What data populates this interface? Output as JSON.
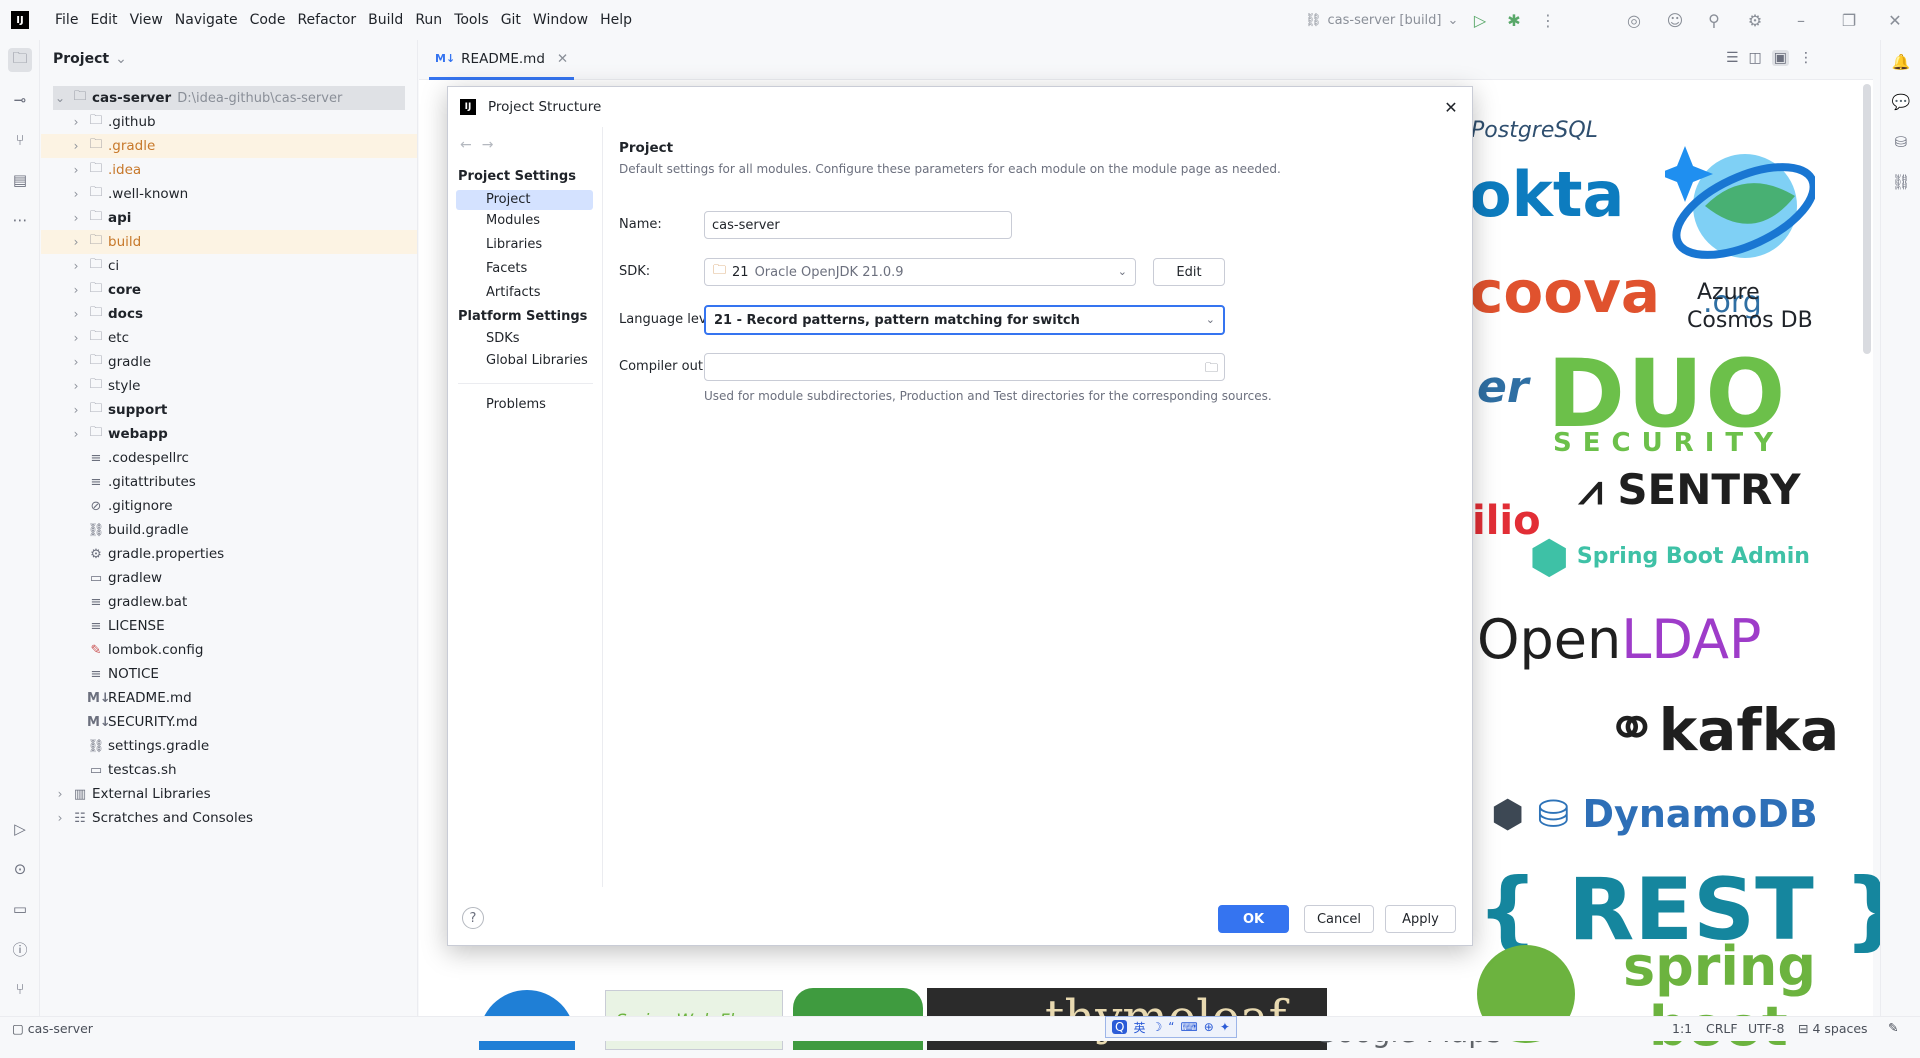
{
  "menu": [
    "File",
    "Edit",
    "View",
    "Navigate",
    "Code",
    "Refactor",
    "Build",
    "Run",
    "Tools",
    "Git",
    "Window",
    "Help"
  ],
  "run_config": "cas-server [build]",
  "project_panel": {
    "title": "Project",
    "root_name": "cas-server",
    "root_path": "D:\\idea-github\\cas-server",
    "items": [
      {
        "label": ".github"
      },
      {
        "label": ".gradle"
      },
      {
        "label": ".idea"
      },
      {
        "label": ".well-known"
      },
      {
        "label": "api"
      },
      {
        "label": "build"
      },
      {
        "label": "ci"
      },
      {
        "label": "core"
      },
      {
        "label": "docs"
      },
      {
        "label": "etc"
      },
      {
        "label": "gradle"
      },
      {
        "label": "style"
      },
      {
        "label": "support"
      },
      {
        "label": "webapp"
      },
      {
        "label": ".codespellrc"
      },
      {
        "label": ".gitattributes"
      },
      {
        "label": ".gitignore"
      },
      {
        "label": "build.gradle"
      },
      {
        "label": "gradle.properties"
      },
      {
        "label": "gradlew"
      },
      {
        "label": "gradlew.bat"
      },
      {
        "label": "LICENSE"
      },
      {
        "label": "lombok.config"
      },
      {
        "label": "NOTICE"
      },
      {
        "label": "README.md"
      },
      {
        "label": "SECURITY.md"
      },
      {
        "label": "settings.gradle"
      },
      {
        "label": "testcas.sh"
      }
    ],
    "external_libraries": "External Libraries",
    "scratches": "Scratches and Consoles"
  },
  "editor": {
    "tab_label": "README.md",
    "md_badge": "M↓"
  },
  "preview_logos": {
    "postgresql": "PostgreSQL",
    "okta": "okta",
    "coova": "coova",
    "coova_org": ".org",
    "azure": "Azure",
    "cosmos": "Cosmos DB",
    "duo": "DUO",
    "duo_security": "SECURITY",
    "sentry": "SENTRY",
    "spring_boot_admin": "Spring Boot Admin",
    "openldap_open": "Open",
    "openldap_ldap": "LDAP",
    "kafka": "kafka",
    "dynamodb": "DynamoDB",
    "rest": "{ REST }",
    "spring": "spring",
    "boot": "boot",
    "spring_web_flow": "Spring Web Flow",
    "thymeleaf": "thymeleaf",
    "google_maps": "Google Maps",
    "twilio": "ilio",
    "er": "er"
  },
  "dialog": {
    "title": "Project Structure",
    "nav": {
      "project_settings": "Project Settings",
      "project_settings_items": [
        "Project",
        "Modules",
        "Libraries",
        "Facets",
        "Artifacts"
      ],
      "platform_settings": "Platform Settings",
      "platform_settings_items": [
        "SDKs",
        "Global Libraries"
      ],
      "problems": "Problems"
    },
    "content": {
      "title": "Project",
      "description": "Default settings for all modules. Configure these parameters for each module on the module page as needed.",
      "name_label": "Name:",
      "name_value": "cas-server",
      "sdk_label": "SDK:",
      "sdk_version": "21",
      "sdk_name": "Oracle OpenJDK 21.0.9",
      "edit_button": "Edit",
      "language_level_label": "Language level:",
      "language_level_value": "21 - Record patterns, pattern matching for switch",
      "compiler_output_label": "Compiler output:",
      "compiler_output_value": "",
      "compiler_output_hint": "Used for module subdirectories, Production and Test directories for the corresponding sources."
    },
    "buttons": {
      "help": "?",
      "ok": "OK",
      "cancel": "Cancel",
      "apply": "Apply"
    }
  },
  "statusbar": {
    "project": "cas-server",
    "position": "1:1",
    "line_sep": "CRLF",
    "encoding": "UTF-8",
    "indent": "4 spaces",
    "ime_lang": "英"
  }
}
